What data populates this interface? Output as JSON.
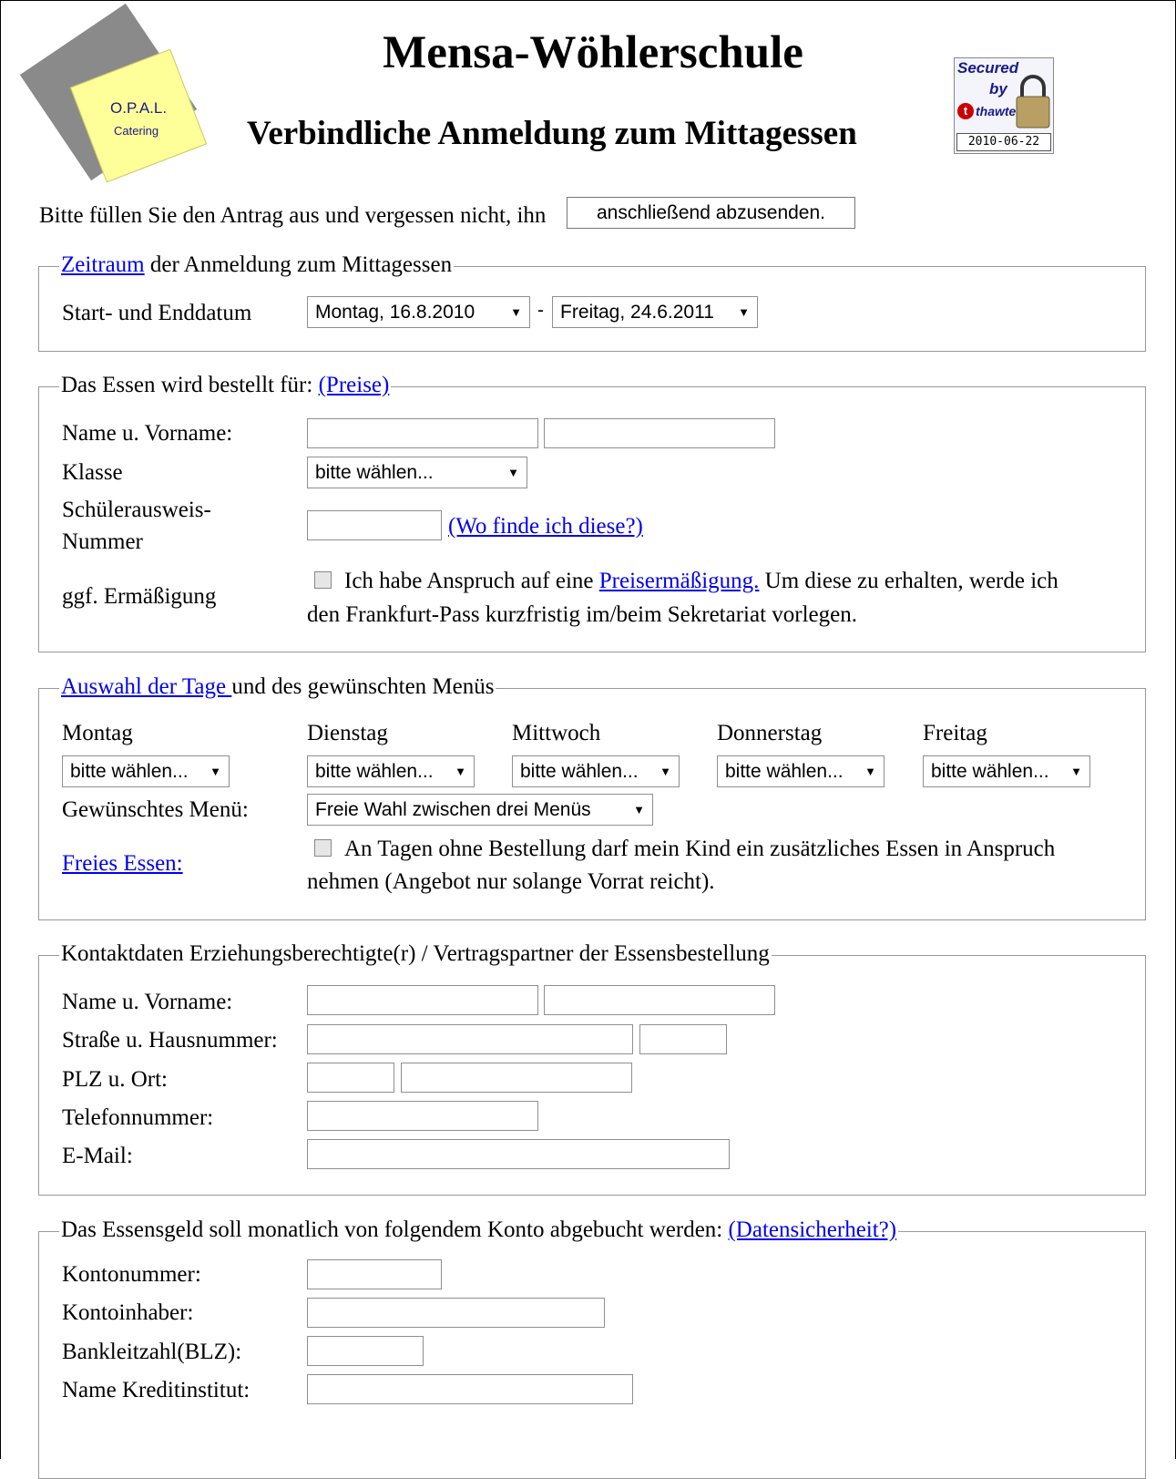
{
  "header": {
    "title": "Mensa-Wöhlerschule",
    "subtitle": "Verbindliche Anmeldung zum Mittagessen",
    "logo": {
      "line1": "O.P.A.L.",
      "line2": "Catering"
    },
    "seal": {
      "secured": "Secured",
      "by": "by",
      "brand": "thawte",
      "date": "2010-06-22"
    }
  },
  "intro": {
    "text": "Bitte füllen Sie den Antrag aus und vergessen nicht, ihn",
    "submit_label": "anschließend abzusenden."
  },
  "period": {
    "legend_link": "Zeitraum",
    "legend_rest": " der Anmeldung zum Mittagessen",
    "label": "Start- und Enddatum",
    "start": "Montag, 16.8.2010",
    "separator": "-",
    "end": "Freitag, 24.6.2011"
  },
  "student": {
    "legend_text": "Das Essen wird bestellt für: ",
    "legend_link": "(Preise)",
    "name_label": "Name u. Vorname:",
    "class_label": "Klasse",
    "class_value": "bitte wählen...",
    "id_label_1": "Schülerausweis-",
    "id_label_2": "Nummer",
    "id_help": "(Wo finde ich diese?)",
    "discount_label": "ggf. Ermäßigung",
    "discount_text_1": "Ich habe Anspruch auf eine ",
    "discount_link": "Preisermäßigung.",
    "discount_text_2": " Um diese zu erhalten, werde ich",
    "discount_text_3": "den Frankfurt-Pass kurzfristig im/beim Sekretariat vorlegen."
  },
  "days": {
    "legend_link": "Auswahl der Tage ",
    "legend_rest": "und des gewünschten Menüs",
    "names": [
      "Montag",
      "Dienstag",
      "Mittwoch",
      "Donnerstag",
      "Freitag"
    ],
    "values": [
      "bitte wählen...",
      "bitte wählen...",
      "bitte wählen...",
      "bitte wählen...",
      "bitte wählen..."
    ],
    "menu_label": "Gewünschtes Menü:",
    "menu_value": "Freie Wahl zwischen drei Menüs",
    "free_link": "Freies Essen:",
    "free_text_1": "An Tagen ohne Bestellung darf mein Kind ein zusätzliches Essen in Anspruch",
    "free_text_2": "nehmen (Angebot nur solange Vorrat reicht)."
  },
  "contact": {
    "legend": "Kontaktdaten Erziehungsberechtigte(r) / Vertragspartner der Essensbestellung",
    "name_label": "Name u. Vorname:",
    "street_label": "Straße u. Hausnummer:",
    "city_label": "PLZ u. Ort:",
    "phone_label": "Telefonnummer:",
    "email_label": "E-Mail:"
  },
  "bank": {
    "legend_text": "Das Essensgeld soll monatlich von folgendem Konto abgebucht werden: ",
    "legend_link": "(Datensicherheit?)",
    "account_label": "Kontonummer:",
    "holder_label": "Kontoinhaber:",
    "blz_label": "Bankleitzahl(BLZ):",
    "institute_label": "Name Kreditinstitut:"
  }
}
